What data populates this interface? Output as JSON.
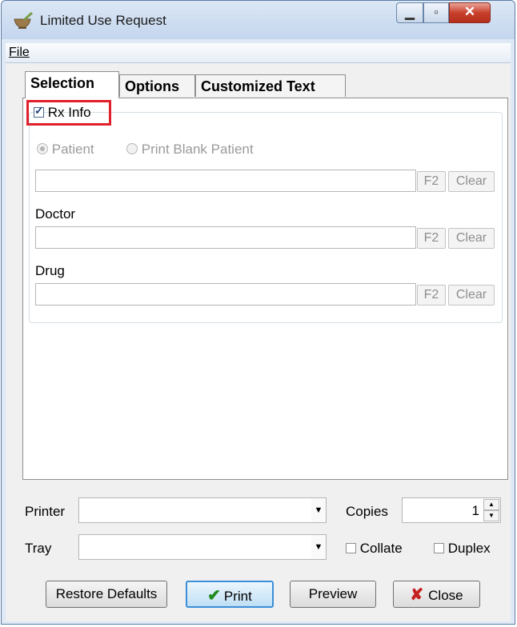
{
  "window": {
    "title": "Limited Use Request"
  },
  "menu": {
    "file": "File"
  },
  "tabs": [
    {
      "label": "Selection",
      "selected": true
    },
    {
      "label": "Options",
      "selected": false
    },
    {
      "label": "Customized Text",
      "selected": false
    }
  ],
  "rx_info": {
    "label": "Rx Info",
    "checked": true
  },
  "patient": {
    "radio_patient": "Patient",
    "radio_blank": "Print Blank Patient",
    "value": "",
    "f2": "F2",
    "clear": "Clear"
  },
  "doctor": {
    "label": "Doctor",
    "value": "",
    "f2": "F2",
    "clear": "Clear"
  },
  "drug": {
    "label": "Drug",
    "value": "",
    "f2": "F2",
    "clear": "Clear"
  },
  "printer": {
    "label": "Printer",
    "value": ""
  },
  "tray": {
    "label": "Tray",
    "value": ""
  },
  "copies": {
    "label": "Copies",
    "value": "1"
  },
  "collate": {
    "label": "Collate",
    "checked": false
  },
  "duplex": {
    "label": "Duplex",
    "checked": false
  },
  "buttons": {
    "restore": "Restore Defaults",
    "print": "Print",
    "preview": "Preview",
    "close": "Close"
  },
  "colors": {
    "highlight": "#e0202a",
    "accent": "#3c8ed8"
  }
}
